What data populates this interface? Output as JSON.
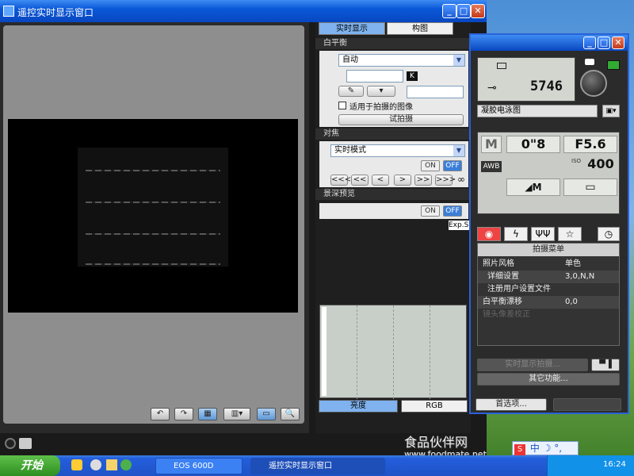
{
  "liveview_window": {
    "title": "遥控实时显示窗口",
    "tabs": [
      "实时显示",
      "构图"
    ],
    "white_balance": {
      "header": "白平衡",
      "mode": "自动",
      "kelvin_label": "K",
      "apply_checkbox_label": "适用于拍摄的图像",
      "test_shoot_label": "试拍摄"
    },
    "focus": {
      "header": "对焦",
      "mode": "实时模式",
      "on_label": "ON",
      "off_label": "OFF",
      "nav_buttons": [
        "<<<",
        "<<",
        "<",
        ">",
        ">>",
        ">>>"
      ],
      "infinity_symbol": "∞"
    },
    "dof_preview": {
      "header": "景深预览",
      "on_label": "ON",
      "off_label": "OFF",
      "exp_sim_label": "Exp.SI"
    },
    "histogram_tabs": [
      "亮度",
      "RGB"
    ]
  },
  "camera_panel": {
    "shots_remaining": "5746",
    "picture_style": "凝胶电泳图",
    "mode": "M",
    "shutter": "0\"8",
    "aperture": "F5.6",
    "white_balance_icon": "AWB",
    "iso_label": "ISO",
    "iso": "400",
    "quality": "◢M",
    "menu_title": "拍摄菜单",
    "menu_rows": [
      {
        "key": "照片风格",
        "value": "单色"
      },
      {
        "key": "详细设置",
        "value": "3,0,N,N"
      },
      {
        "key": "注册用户设置文件",
        "value": ""
      },
      {
        "key": "白平衡漂移",
        "value": "0,0"
      },
      {
        "key": "镜头像差校正",
        "value": ""
      }
    ],
    "liveview_shoot_button": "实时显示拍摄...",
    "other_functions_button": "其它功能...",
    "preferences_button": "首选项..."
  },
  "taskbar": {
    "start_label": "开始",
    "items": [
      "EOS 600D",
      "遥控实时显示窗口"
    ],
    "clock": "16:24",
    "ime_text": "中"
  },
  "watermark": {
    "text": "食品伙伴网",
    "url": "www.foodmate.net"
  }
}
